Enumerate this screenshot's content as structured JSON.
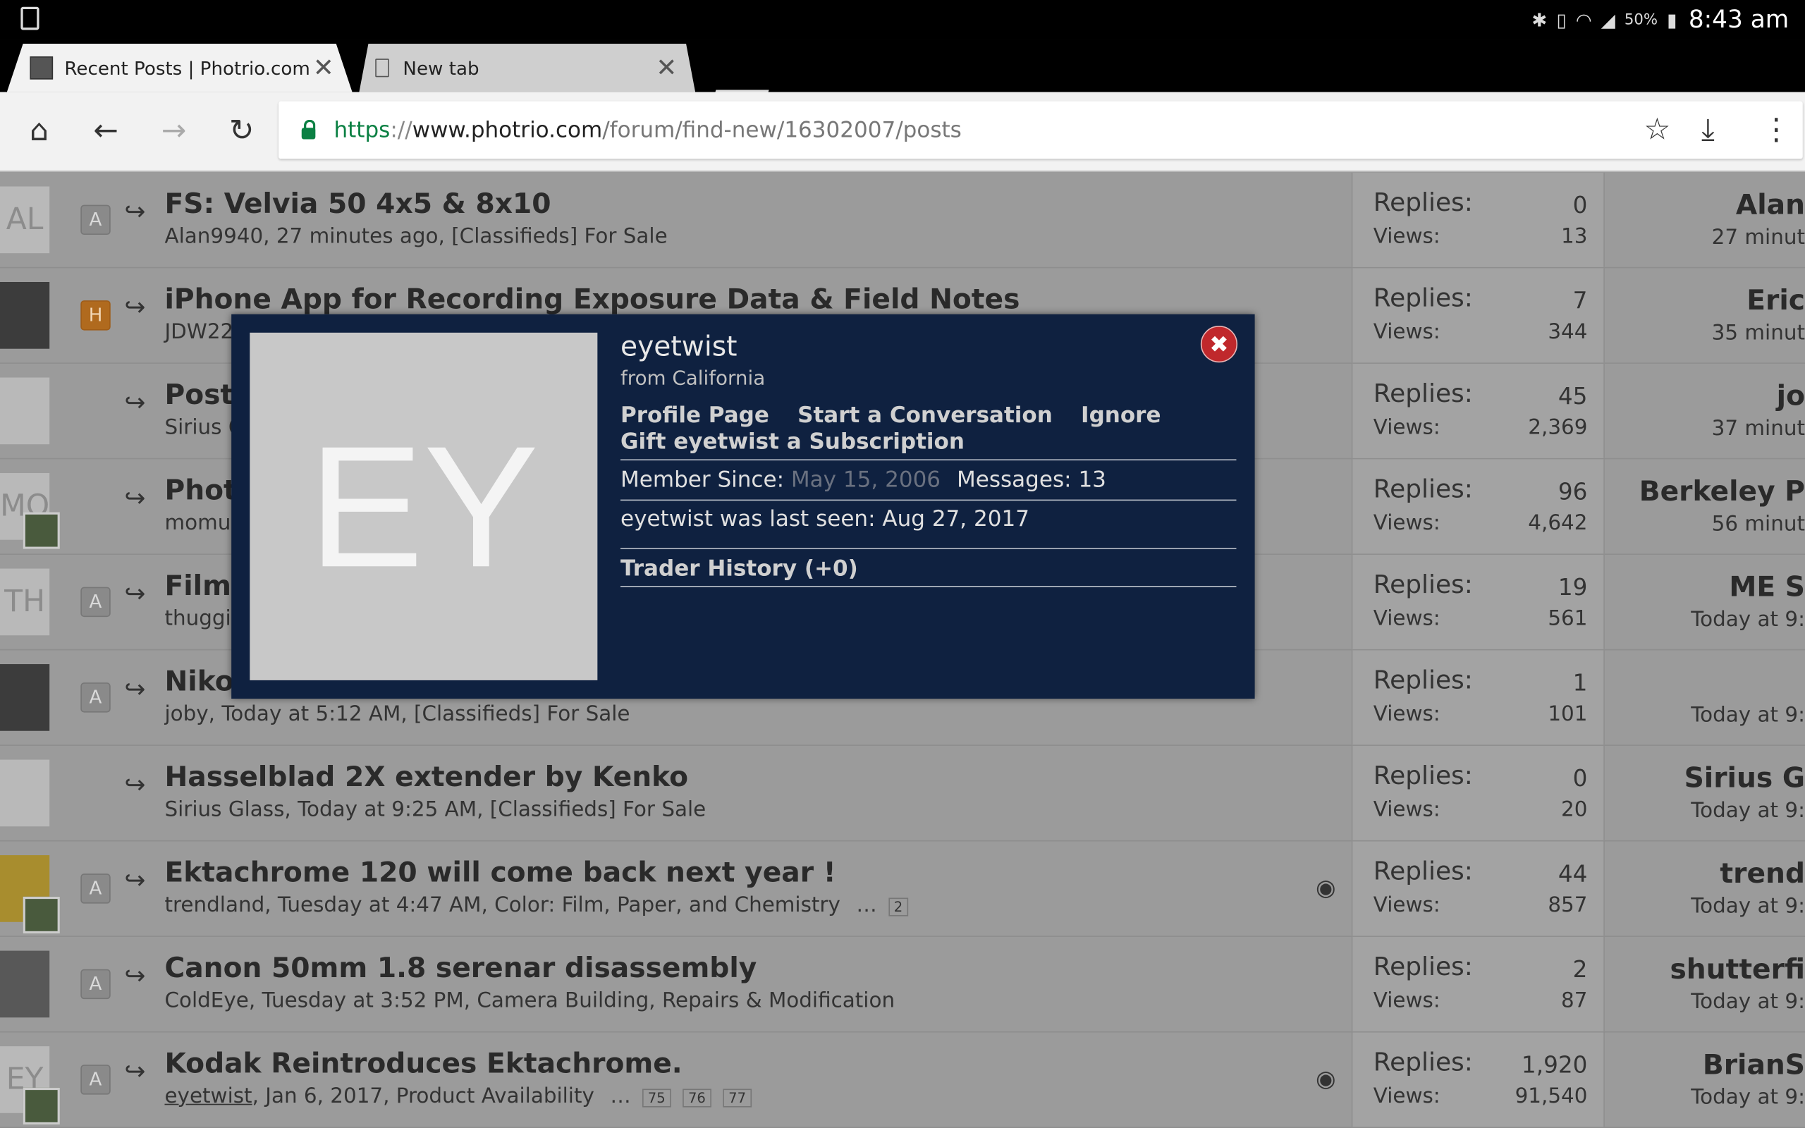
{
  "statusbar": {
    "battery_pct": "50%",
    "time": "8:43 am"
  },
  "tabs": [
    {
      "title": "Recent Posts | Photrio.com P",
      "close": "✕"
    },
    {
      "title": "New tab",
      "close": "✕"
    }
  ],
  "toolbar": {
    "home": "⌂",
    "back": "←",
    "forward": "→",
    "reload": "↻",
    "url_scheme": "https",
    "url_sep": "://",
    "url_host": "www.photrio.com",
    "url_path": "/forum/find-new/16302007/posts",
    "bookmark": "☆",
    "download": "⤓",
    "menu": "⋮"
  },
  "threads": [
    {
      "avatar": "AL",
      "prefix": "A",
      "title": "FS: Velvia 50 4x5 & 8x10",
      "meta": "Alan9940, 27 minutes ago, [Classifieds] For Sale",
      "replies_label": "Replies:",
      "replies": "0",
      "views_label": "Views:",
      "views": "13",
      "last_user": "Alan",
      "last_time": "27 minut"
    },
    {
      "avatar": "",
      "prefix": "H",
      "title": "iPhone App for Recording Exposure Data & Field Notes",
      "meta": "JDW22",
      "replies_label": "Replies:",
      "replies": "7",
      "views_label": "Views:",
      "views": "344",
      "last_user": "Eric",
      "last_time": "35 minut"
    },
    {
      "avatar": "",
      "prefix": "",
      "title": "Post",
      "meta": "Sirius G",
      "replies_label": "Replies:",
      "replies": "45",
      "views_label": "Views:",
      "views": "2,369",
      "last_user": "jo",
      "last_time": "37 minut"
    },
    {
      "avatar": "MO",
      "prefix": "",
      "title": "Photo",
      "meta": "momu",
      "replies_label": "Replies:",
      "replies": "96",
      "views_label": "Views:",
      "views": "4,642",
      "last_user": "Berkeley P",
      "last_time": "56 minut"
    },
    {
      "avatar": "TH",
      "prefix": "A",
      "title": "Film",
      "meta": "thuggi",
      "replies_label": "Replies:",
      "replies": "19",
      "views_label": "Views:",
      "views": "561",
      "last_user": "ME S",
      "last_time": "Today at 9:"
    },
    {
      "avatar": "",
      "prefix": "A",
      "title": "Niko",
      "meta": "joby, Today at 5:12 AM, [Classifieds] For Sale",
      "replies_label": "Replies:",
      "replies": "1",
      "views_label": "Views:",
      "views": "101",
      "last_user": "",
      "last_time": "Today at 9:"
    },
    {
      "avatar": "",
      "prefix": "",
      "title": "Hasselblad 2X extender by Kenko",
      "meta": "Sirius Glass, Today at 9:25 AM, [Classifieds] For Sale",
      "replies_label": "Replies:",
      "replies": "0",
      "views_label": "Views:",
      "views": "20",
      "last_user": "Sirius G",
      "last_time": "Today at 9:"
    },
    {
      "avatar": "",
      "prefix": "A",
      "title": "Ektachrome 120 will come back next year !",
      "meta": "trendland, Tuesday at 4:47 AM, Color: Film, Paper, and Chemistry",
      "meta_ellipsis": "…",
      "pages": [
        "2"
      ],
      "replies_label": "Replies:",
      "replies": "44",
      "views_label": "Views:",
      "views": "857",
      "last_user": "trend",
      "last_time": "Today at 9:"
    },
    {
      "avatar": "",
      "prefix": "A",
      "title": "Canon 50mm 1.8 serenar disassembly",
      "meta": "ColdEye, Tuesday at 3:52 PM, Camera Building, Repairs & Modification",
      "replies_label": "Replies:",
      "replies": "2",
      "views_label": "Views:",
      "views": "87",
      "last_user": "shutterfi",
      "last_time": "Today at 9:"
    },
    {
      "avatar": "EY",
      "prefix": "A",
      "title": "Kodak Reintroduces Ektachrome.",
      "meta_user": "eyetwist",
      "meta": ", Jan 6, 2017, Product Availability",
      "meta_ellipsis": "…",
      "pages": [
        "75",
        "76",
        "77"
      ],
      "replies_label": "Replies:",
      "replies": "1,920",
      "views_label": "Views:",
      "views": "91,540",
      "last_user": "BrianS",
      "last_time": "Today at 9:"
    }
  ],
  "member_card": {
    "avatar_initials": "EY",
    "close": "✖",
    "username": "eyetwist",
    "location": "from California",
    "links": [
      "Profile Page",
      "Start a Conversation",
      "Ignore"
    ],
    "gift": "Gift eyetwist a Subscription",
    "member_since_label": "Member Since:",
    "member_since": "May 15, 2006",
    "messages_label": "Messages:",
    "messages": "13",
    "last_seen": "eyetwist was last seen: Aug 27, 2017",
    "trader_history": "Trader History (+0)"
  }
}
